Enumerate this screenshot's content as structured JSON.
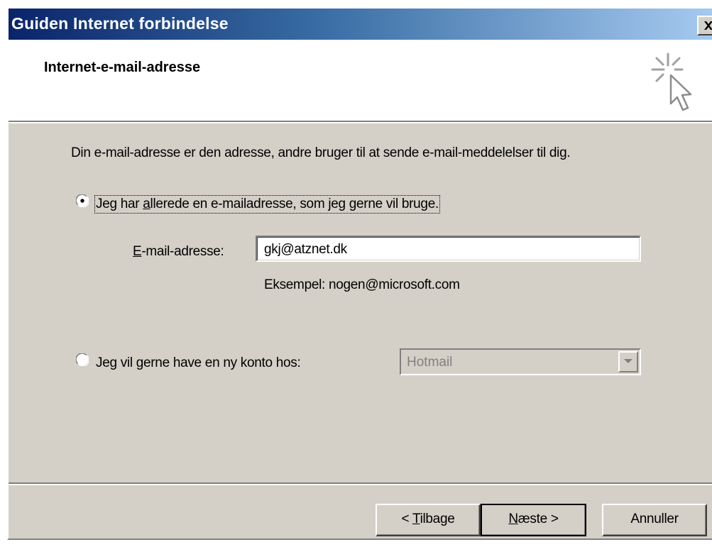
{
  "window": {
    "title": "Guiden Internet forbindelse",
    "close_label": "×"
  },
  "header": {
    "title": "Internet-e-mail-adresse",
    "icon": "wizard-sparkle-cursor-icon"
  },
  "content": {
    "description": "Din e-mail-adresse er den adresse, andre bruger til at sende e-mail-meddelelser til dig.",
    "option_existing": {
      "label_before": "Jeg har ",
      "label_accel": "a",
      "label_after": "llerede en e-mailadresse, som jeg gerne vil bruge.",
      "selected": true
    },
    "email_field": {
      "label_accel": "E",
      "label_after": "-mail-adresse:",
      "value": "gkj@atznet.dk"
    },
    "example_text": "Eksempel: nogen@microsoft.com",
    "option_new": {
      "label_before": "Jeg vil ",
      "label_accel": "g",
      "label_after": "erne have en ny konto hos:",
      "selected": false
    },
    "provider_select": {
      "value": "Hotmail",
      "enabled": false
    }
  },
  "footer": {
    "back": {
      "prefix": "< ",
      "accel": "T",
      "rest": "ilbage"
    },
    "next": {
      "accel": "N",
      "rest": "æste",
      "suffix": " >"
    },
    "cancel": "Annuller"
  },
  "colors": {
    "titlebar_start": "#0a246a",
    "titlebar_end": "#a6caf0",
    "dialog_face": "#d4d0c8"
  }
}
